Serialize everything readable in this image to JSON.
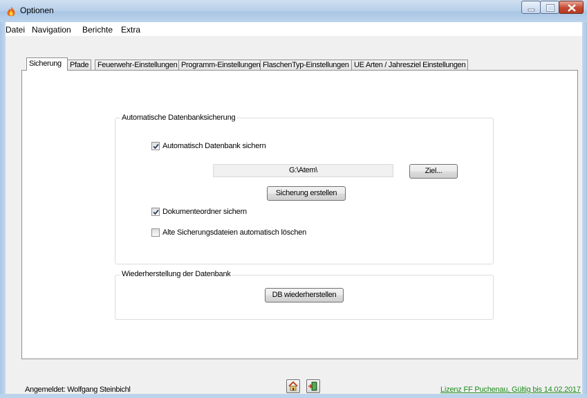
{
  "window": {
    "title": "Optionen"
  },
  "menu": [
    "Datei",
    "Navigation",
    "Berichte",
    "Extra"
  ],
  "tabs": [
    "Sicherung",
    "Pfade",
    "Feuerwehr-Einstellungen",
    "Programm-Einstellungen",
    "FlaschenTyp-Einstellungen",
    "UE Arten / Jahresziel Einstellungen"
  ],
  "backup_group": {
    "title": "Automatische Datenbanksicherung",
    "auto_backup": {
      "label": "Automatisch Datenbank sichern",
      "checked": true
    },
    "path_value": "G:\\Atem\\",
    "target_button": "Ziel...",
    "create_button": "Sicherung erstellen",
    "documents": {
      "label": "Dokumenteordner sichern",
      "checked": true
    },
    "delete_old": {
      "label": "Alte Sicherungsdateien automatisch löschen",
      "checked": false
    }
  },
  "restore_group": {
    "title": "Wiederherstellung der Datenbank",
    "restore_button": "DB wiederherstellen"
  },
  "status": {
    "logged_in": "Angemeldet: Wolfgang Steinbichl",
    "license": "Lizenz FF Puchenau, Gültig bis 14.02.2017"
  },
  "icons": {
    "app": "flame-icon",
    "home": "home-icon",
    "exit": "exit-door-icon"
  },
  "colors": {
    "license_text": "#1e8c1e",
    "close_button": "#c24a31"
  }
}
